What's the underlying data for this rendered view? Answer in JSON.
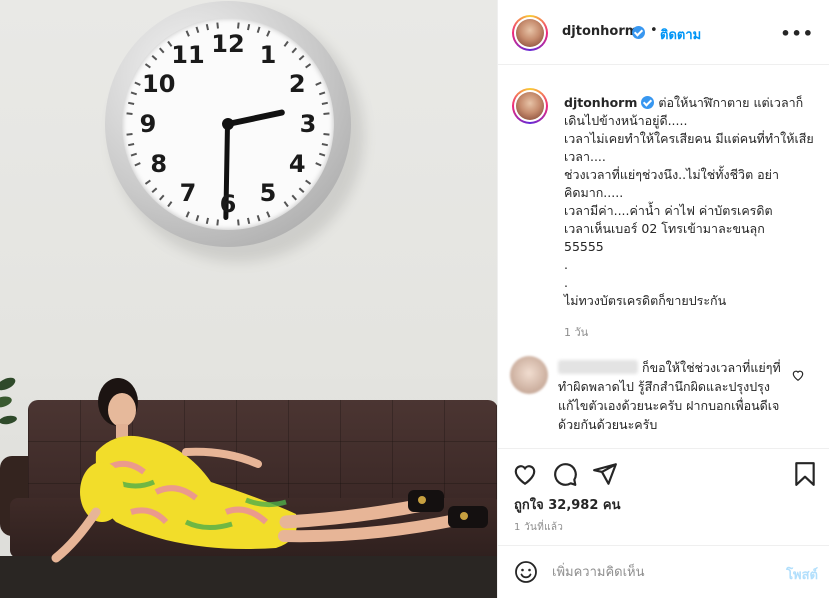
{
  "photo": {
    "clock_numbers": [
      "12",
      "1",
      "2",
      "3",
      "4",
      "5",
      "6",
      "7",
      "8",
      "9",
      "10",
      "11"
    ],
    "clock_time": "02:32",
    "accent_dress": "#f2dd2a",
    "sofa_color": "#3e2a27"
  },
  "header": {
    "username": "djtonhorm",
    "separator": "•",
    "follow_label": "ติดตาม",
    "more_icon": "more-options-icon"
  },
  "caption": {
    "username": "djtonhorm",
    "text": "ต่อให้นาฬิกาตาย แต่เวลาก็เดินไปข้างหน้าอยู่ดี.....\nเวลาไม่เคยทำให้ใครเสียคน มีแต่คนที่ทำให้เสียเวลา....\nช่วงเวลาที่แย่ๆช่วงนึง..ไม่ใช่ทั้งชีวิต อย่าคิดมาก.....\nเวลามีค่า....ค่าน้ำ ค่าไฟ ค่าบัตรเครดิต\nเวลาเห็นเบอร์ 02 โทรเข้ามาละขนลุก\n55555\n.\n.\nไม่ทวงบัตรเครดิตก็ขายประกัน",
    "time": "1 วัน"
  },
  "comment": {
    "text": "ก็ขอให้ใช่ช่วงเวลาที่แย่ๆที่ทำผิดพลาดไป รู้สึกสำนึกผิดและปรุงปรุงแก้ไขตัวเองด้วยนะครับ ฝากบอกเพื่อนดีเจด้วยกันด้วยนะครับ"
  },
  "actions": {
    "likes_text": "ถูกใจ 32,982 คน",
    "posted_time": "1 วันที่แล้ว"
  },
  "add_comment": {
    "placeholder": "เพิ่มความคิดเห็น",
    "post_label": "โพสต์"
  },
  "colors": {
    "link_blue": "#0095f6",
    "verified_blue": "#3897f0",
    "post_disabled": "#b2dffc"
  }
}
